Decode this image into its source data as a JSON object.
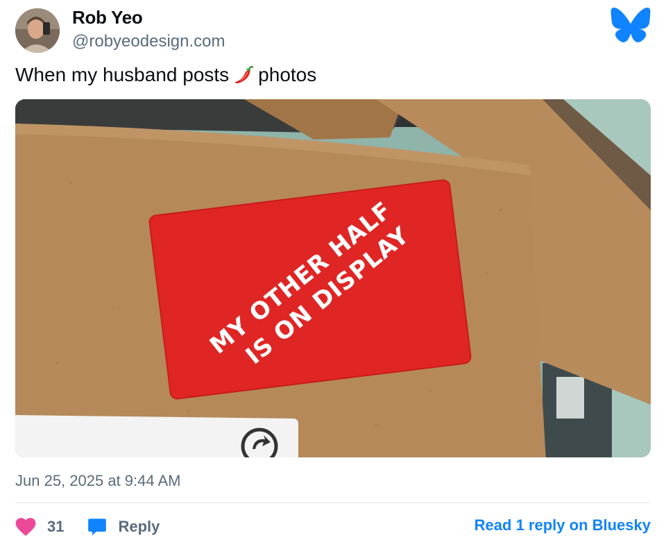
{
  "author": {
    "display_name": "Rob Yeo",
    "handle": "@robyeodesign.com"
  },
  "post": {
    "text_before": "When my husband posts",
    "emoji": "chili-pepper",
    "text_after": "photos",
    "image": {
      "sticker_line1": "MY OTHER HALF",
      "sticker_line2": "IS ON DISPLAY"
    },
    "timestamp": "Jun 25, 2025 at 9:44 AM"
  },
  "actions": {
    "like_count": "31",
    "reply_label": "Reply",
    "read_link": "Read 1 reply on Bluesky"
  },
  "colors": {
    "brand": "#1083fe",
    "like": "#ec4899",
    "muted": "#5a6b7d",
    "sticker_red": "#e02525",
    "cardboard": "#b98a58"
  }
}
